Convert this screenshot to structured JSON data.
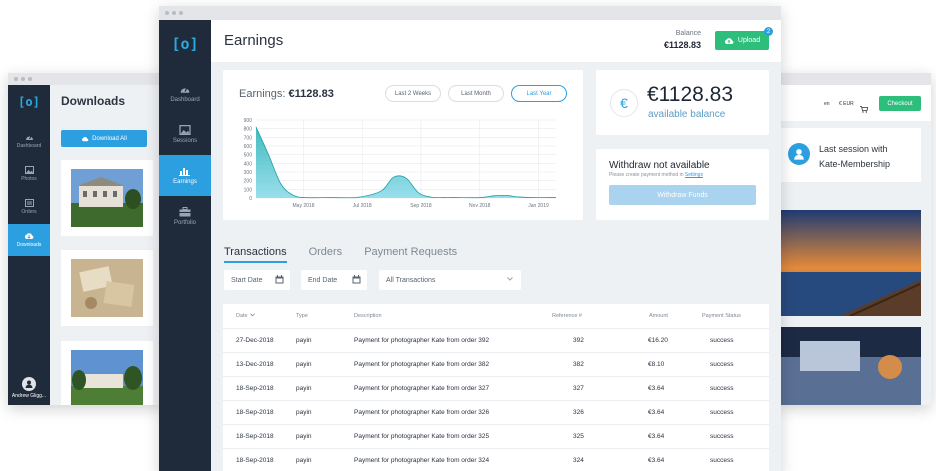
{
  "left_window": {
    "logo": "[o]",
    "nav": [
      {
        "label": "Dashboard",
        "icon": "dashboard-icon"
      },
      {
        "label": "Photos",
        "icon": "photos-icon"
      },
      {
        "label": "Orders",
        "icon": "orders-icon"
      },
      {
        "label": "Downloads",
        "icon": "cloud-download-icon",
        "active": true
      }
    ],
    "title": "Downloads",
    "download_all_label": "Download All",
    "user_name": "Andrew Gligg..."
  },
  "main_window": {
    "logo": "[o]",
    "nav": [
      {
        "label": "Dashboard",
        "icon": "dashboard-icon"
      },
      {
        "label": "Sessions",
        "icon": "sessions-icon"
      },
      {
        "label": "Earnings",
        "icon": "bar-chart-icon",
        "active": true
      },
      {
        "label": "Portfolio",
        "icon": "briefcase-icon"
      }
    ],
    "title": "Earnings",
    "balance_label": "Balance",
    "balance_value": "€1128.83",
    "upload_label": "Upload",
    "upload_badge": "2",
    "earnings_card": {
      "title_prefix": "Earnings:",
      "title_value": "€1128.83",
      "periods": [
        "Last 2 Weeks",
        "Last Month",
        "Last Year"
      ],
      "active_period": "Last Year"
    },
    "balance_card": {
      "currency_symbol": "€",
      "amount": "€1128.83",
      "subtitle": "available balance"
    },
    "withdraw_card": {
      "title": "Withdraw not available",
      "note_prefix": "Please create payment method in",
      "note_link": "Settings",
      "button_label": "Withdraw Funds"
    },
    "tabs": [
      "Transactions",
      "Orders",
      "Payment Requests"
    ],
    "filters": {
      "start_date_placeholder": "Start Date",
      "end_date_placeholder": "End Date",
      "type_selected": "All Transactions"
    },
    "table": {
      "headers": [
        "Date",
        "Type",
        "Description",
        "Reference #",
        "Amount",
        "Payment Status"
      ],
      "rows": [
        [
          "27-Dec-2018",
          "payin",
          "Payment for photographer Kate from order 392",
          "392",
          "€16.20",
          "success"
        ],
        [
          "13-Dec-2018",
          "payin",
          "Payment for photographer Kate from order 382",
          "382",
          "€8.10",
          "success"
        ],
        [
          "18-Sep-2018",
          "payin",
          "Payment for photographer Kate from order 327",
          "327",
          "€3.64",
          "success"
        ],
        [
          "18-Sep-2018",
          "payin",
          "Payment for photographer Kate from order 326",
          "326",
          "€3.64",
          "success"
        ],
        [
          "18-Sep-2018",
          "payin",
          "Payment for photographer Kate from order 325",
          "325",
          "€3.64",
          "success"
        ],
        [
          "18-Sep-2018",
          "payin",
          "Payment for photographer Kate from order 324",
          "324",
          "€3.64",
          "success"
        ]
      ]
    }
  },
  "right_window": {
    "lang": "en",
    "currency": "€ EUR",
    "checkout_label": "Checkout",
    "session_line1": "Last session with",
    "session_line2": "Kate-Membership"
  },
  "chart_data": {
    "type": "area",
    "title": "",
    "xlabel": "",
    "ylabel": "",
    "x_tick_labels": [
      "May 2018",
      "Jul 2018",
      "Sep 2018",
      "Nov 2018",
      "Jan 2019"
    ],
    "y_ticks": [
      0,
      100,
      200,
      300,
      400,
      500,
      600,
      700,
      800,
      900
    ],
    "ylim": [
      0,
      900
    ],
    "xlim": [
      0,
      12
    ],
    "grid": true,
    "color": "#2bb3b6",
    "series": [
      {
        "x": [
          0,
          0.5,
          1,
          1.5,
          2,
          3,
          4,
          5,
          5.5,
          6,
          6.5,
          7,
          7.5,
          8,
          9,
          9.5,
          10,
          10.5,
          11,
          12
        ],
        "values": [
          820,
          500,
          160,
          30,
          5,
          5,
          5,
          80,
          240,
          230,
          60,
          10,
          5,
          5,
          5,
          25,
          30,
          12,
          5,
          5
        ]
      }
    ]
  }
}
